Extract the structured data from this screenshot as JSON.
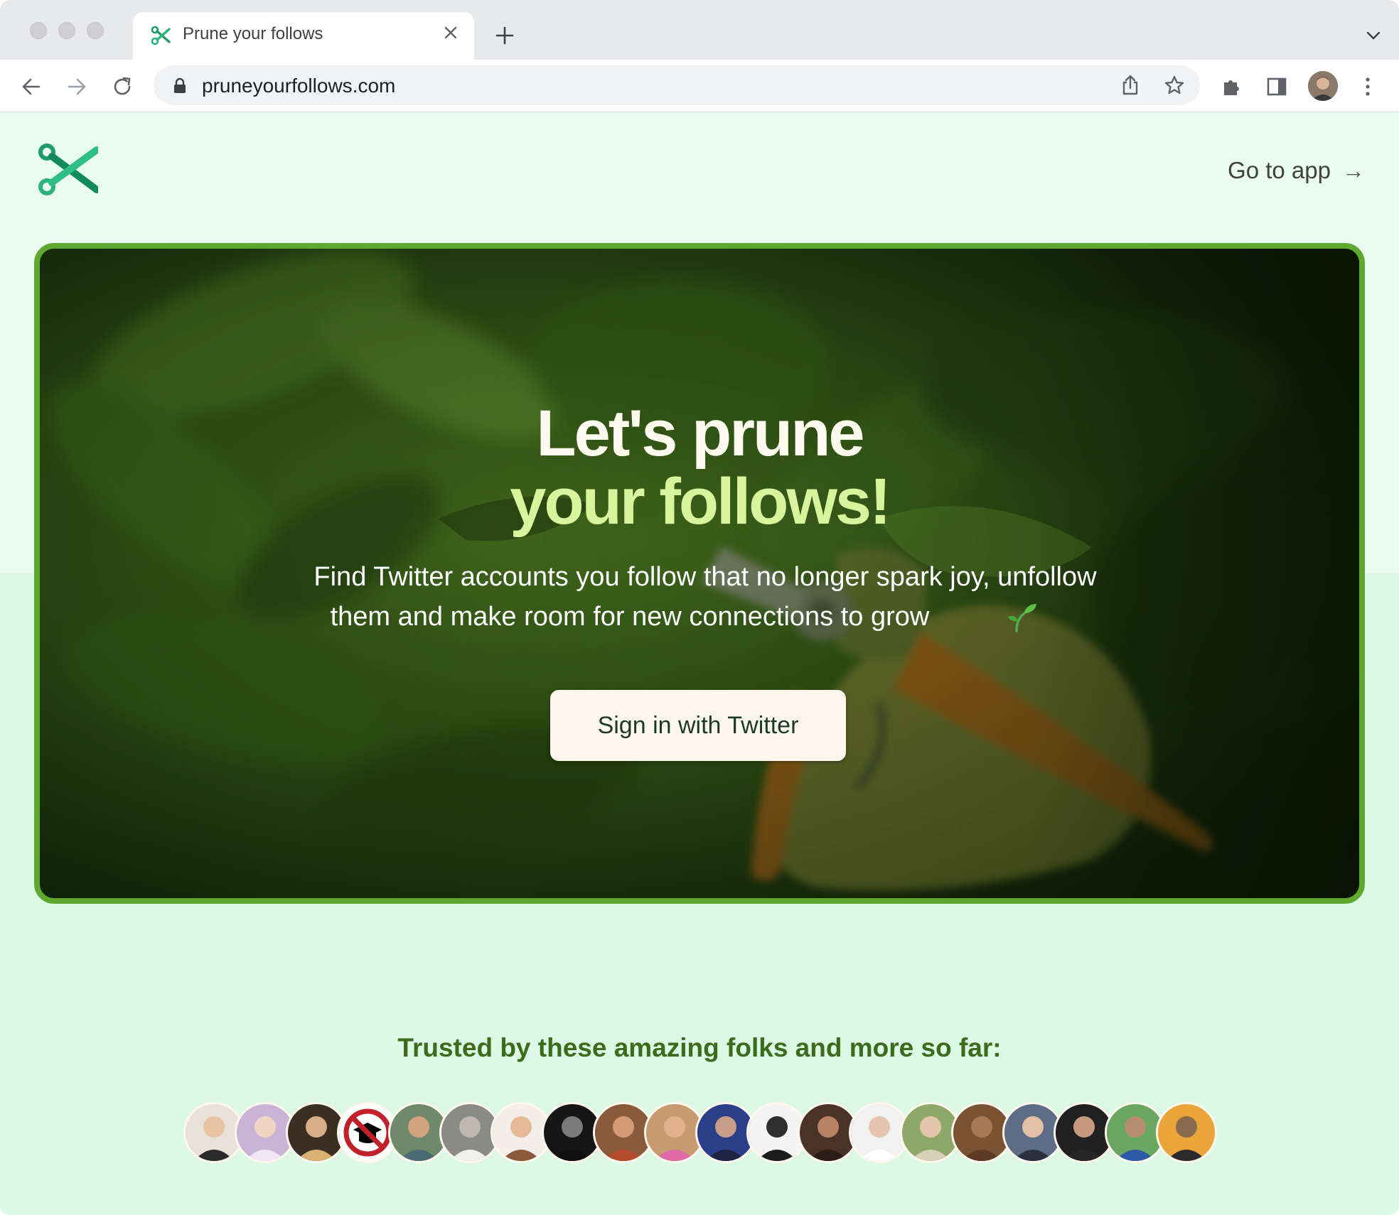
{
  "browser": {
    "tab_title": "Prune your follows",
    "url": "pruneyourfollows.com"
  },
  "header": {
    "go_to_app": "Go to app",
    "arrow": "→"
  },
  "hero": {
    "title_line1": "Let's prune",
    "title_line2": "your follows!",
    "subtitle_line1": "Find Twitter accounts you follow that no longer spark joy, unfollow",
    "subtitle_line2": "them and make room for new connections to grow",
    "cta": "Sign in with Twitter"
  },
  "social_proof": {
    "heading": "Trusted by these amazing folks and more so far:",
    "avatars": [
      {
        "bg": "#e9e2d8",
        "skin": "#e8c3a3",
        "shirt": "#2a2a2a"
      },
      {
        "bg": "#c9b3d6",
        "skin": "#f1d4c2",
        "shirt": "#efe7f4"
      },
      {
        "bg": "#3b2f24",
        "skin": "#d7ad88",
        "shirt": "#d8b070"
      },
      {
        "bg": "#ffffff",
        "skin": "#000000",
        "shirt": "#c0202a"
      },
      {
        "bg": "#6e8a6a",
        "skin": "#d3a27f",
        "shirt": "#4a6b73"
      },
      {
        "bg": "#8b8b86",
        "skin": "#bdb8b0",
        "shirt": "#f0f0ee"
      },
      {
        "bg": "#f3efe8",
        "skin": "#e4b995",
        "shirt": "#8a5a3a"
      },
      {
        "bg": "#151515",
        "skin": "#7a7a7a",
        "shirt": "#101010"
      },
      {
        "bg": "#8a5a3d",
        "skin": "#d39b76",
        "shirt": "#b44b2d"
      },
      {
        "bg": "#c89a72",
        "skin": "#e3b18c",
        "shirt": "#e06aa6"
      },
      {
        "bg": "#2b3e8a",
        "skin": "#c79e88",
        "shirt": "#1d2340"
      },
      {
        "bg": "#f4f4f4",
        "skin": "#2e2e2e",
        "shirt": "#1c1c1c"
      },
      {
        "bg": "#4a3226",
        "skin": "#b88163",
        "shirt": "#2b1d16"
      },
      {
        "bg": "#f1f1f1",
        "skin": "#e6c4b0",
        "shirt": "#ffffff"
      },
      {
        "bg": "#8ea86a",
        "skin": "#e3c6ab",
        "shirt": "#d8d0b8"
      },
      {
        "bg": "#7a5234",
        "skin": "#a77a55",
        "shirt": "#5d3a22"
      },
      {
        "bg": "#5e6d86",
        "skin": "#e4c0a6",
        "shirt": "#2b3140"
      },
      {
        "bg": "#202020",
        "skin": "#c69a7e",
        "shirt": "#262626"
      },
      {
        "bg": "#6aa760",
        "skin": "#b58d70",
        "shirt": "#2e5aa8"
      },
      {
        "bg": "#e9a43a",
        "skin": "#8a6a4c",
        "shirt": "#2a2a2a"
      }
    ]
  },
  "colors": {
    "brand_green": "#2db37a",
    "hero_border": "#5ea830",
    "headline_accent": "#d8f49c",
    "trusted_text": "#3d6b1c"
  },
  "icons": {
    "logo": "scissors-icon",
    "sprout": "seedling-icon"
  }
}
